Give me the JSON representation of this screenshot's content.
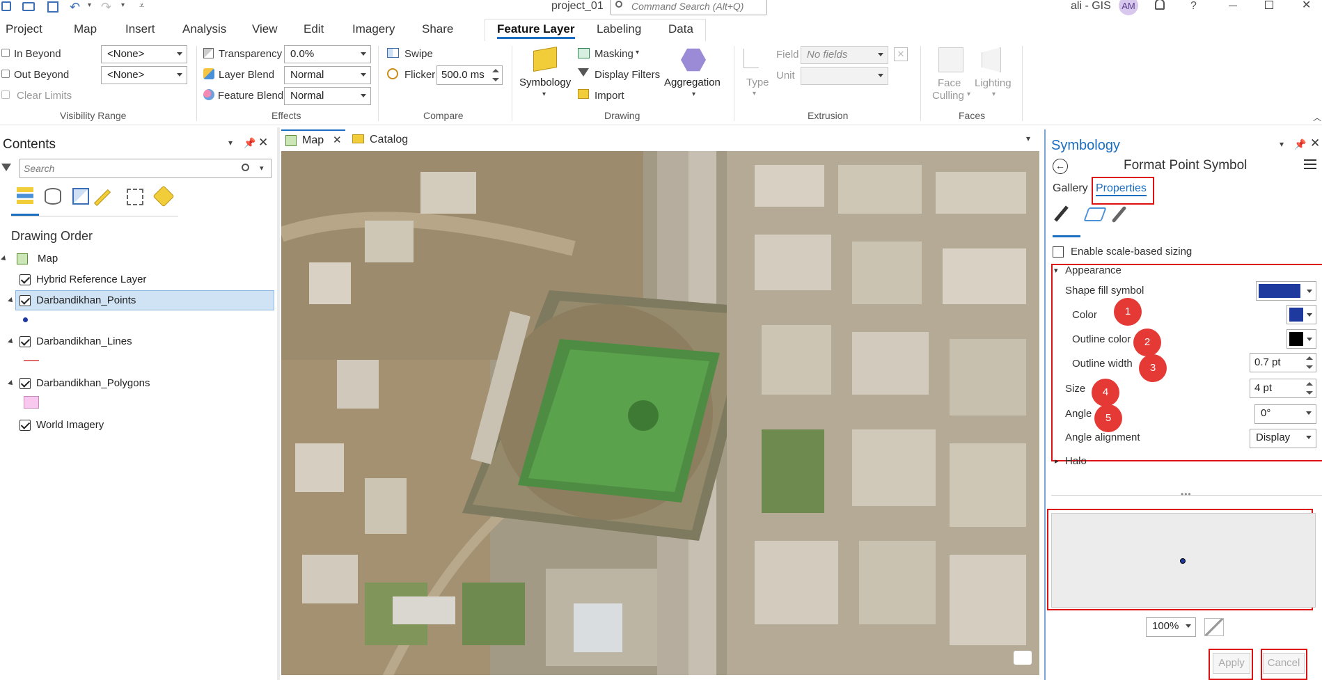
{
  "titlebar": {
    "project": "project_01",
    "search_placeholder": "Command Search (Alt+Q)",
    "user": "ali - GIS",
    "avatar": "AM",
    "help": "?"
  },
  "menu": {
    "items": [
      "Project",
      "Map",
      "Insert",
      "Analysis",
      "View",
      "Edit",
      "Imagery",
      "Share"
    ],
    "context_items": [
      "Feature Layer",
      "Labeling",
      "Data"
    ],
    "active": "Feature Layer"
  },
  "ribbon": {
    "visibility": {
      "in_beyond": "In Beyond",
      "out_beyond": "Out Beyond",
      "clear_limits": "Clear Limits",
      "in_value": "<None>",
      "out_value": "<None>",
      "label": "Visibility Range"
    },
    "effects": {
      "transparency": "Transparency",
      "transparency_value": "0.0%",
      "layer_blend": "Layer Blend",
      "layer_blend_value": "Normal",
      "feature_blend": "Feature Blend",
      "feature_blend_value": "Normal",
      "label": "Effects"
    },
    "compare": {
      "swipe": "Swipe",
      "flicker": "Flicker",
      "flicker_value": "500.0 ms",
      "label": "Compare"
    },
    "drawing": {
      "symbology": "Symbology",
      "masking": "Masking",
      "display_filters": "Display Filters",
      "import": "Import",
      "aggregation": "Aggregation",
      "label": "Drawing"
    },
    "extrusion": {
      "type": "Type",
      "field": "Field",
      "field_value": "No fields",
      "unit": "Unit",
      "label": "Extrusion"
    },
    "faces": {
      "face_culling_1": "Face",
      "face_culling_2": "Culling",
      "lighting": "Lighting",
      "label": "Faces"
    }
  },
  "contents": {
    "title": "Contents",
    "search_placeholder": "Search",
    "drawing_order": "Drawing Order",
    "map": "Map",
    "layers": [
      "Hybrid Reference Layer",
      "Darbandikhan_Points",
      "Darbandikhan_Lines",
      "Darbandikhan_Polygons",
      "World Imagery"
    ]
  },
  "tabs": {
    "map": "Map",
    "catalog": "Catalog"
  },
  "symbology": {
    "title": "Symbology",
    "subtitle": "Format Point Symbol",
    "tab_gallery": "Gallery",
    "tab_properties": "Properties",
    "enable_scale": "Enable scale-based sizing",
    "appearance": "Appearance",
    "shape_fill": "Shape fill symbol",
    "color": "Color",
    "outline_color": "Outline color",
    "outline_width": "Outline width",
    "outline_width_value": "0.7 pt",
    "size": "Size",
    "size_value": "4 pt",
    "angle": "Angle",
    "angle_value": "0°",
    "angle_alignment": "Angle alignment",
    "angle_alignment_value": "Display",
    "halo": "Halo",
    "zoom": "100%",
    "apply": "Apply",
    "cancel": "Cancel",
    "badges": [
      "1",
      "2",
      "3",
      "4",
      "5"
    ],
    "fill_color": "#1f3a9e",
    "outline_color_value": "#000000"
  }
}
